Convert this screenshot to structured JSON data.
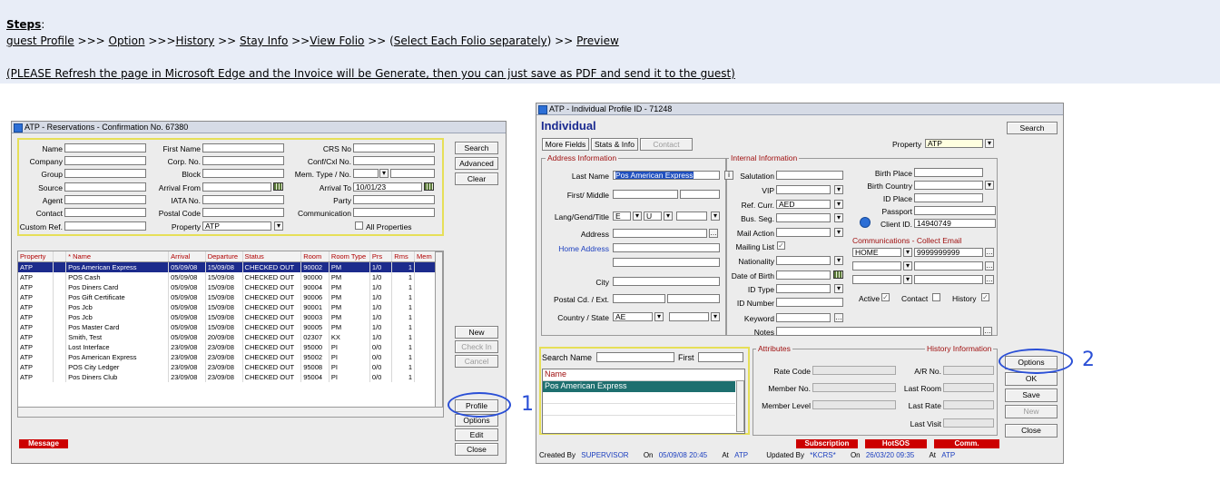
{
  "instructions": {
    "steps_label": "Steps",
    "steps_colon": ":",
    "path": [
      {
        "link": "guest Profile",
        "sep": " >>> "
      },
      {
        "link": "Option",
        "sep": " >>>"
      },
      {
        "link": "History",
        "sep": " >> "
      },
      {
        "link": "Stay Info",
        "sep": " >>"
      },
      {
        "link": "View Folio",
        "sep": " >> ("
      },
      {
        "link": "Select Each Folio separately",
        "sep": ") >> "
      },
      {
        "link": "Preview",
        "sep": ""
      }
    ],
    "note": "(PLEASE Refresh the page in Microsoft Edge and the Invoice will be Generate, then you can just save as PDF and send it to the guest)"
  },
  "reservations": {
    "title": "ATP - Reservations - Confirmation No. 67380",
    "search_labels": {
      "name": "Name",
      "company": "Company",
      "group": "Group",
      "source": "Source",
      "agent": "Agent",
      "contact": "Contact",
      "custom_ref": "Custom Ref.",
      "first_name": "First Name",
      "corp_no": "Corp. No.",
      "block": "Block",
      "arrival_from": "Arrival From",
      "iata_no": "IATA No.",
      "postal_code": "Postal Code",
      "property": "Property",
      "crs_no": "CRS No",
      "conf_cxl_no": "Conf/Cxl No.",
      "mem_type_no": "Mem. Type / No.",
      "arrival_to": "Arrival To",
      "party": "Party",
      "communication": "Communication",
      "all_properties": "All Properties"
    },
    "property_value": "ATP",
    "arrival_to_value": "10/01/23",
    "columns": [
      "Property",
      "",
      "* Name",
      "Arrival",
      "Departure",
      "Status",
      "Room",
      "Room Type",
      "Prs",
      "Rms",
      "Mem"
    ],
    "rows": [
      [
        "ATP",
        "",
        "Pos American Express",
        "05/09/08",
        "15/09/08",
        "CHECKED OUT",
        "90002",
        "PM",
        "1/0",
        "1"
      ],
      [
        "ATP",
        "",
        "POS Cash",
        "05/09/08",
        "15/09/08",
        "CHECKED OUT",
        "90000",
        "PM",
        "1/0",
        "1"
      ],
      [
        "ATP",
        "",
        "Pos Diners Card",
        "05/09/08",
        "15/09/08",
        "CHECKED OUT",
        "90004",
        "PM",
        "1/0",
        "1"
      ],
      [
        "ATP",
        "",
        "Pos Gift Certificate",
        "05/09/08",
        "15/09/08",
        "CHECKED OUT",
        "90006",
        "PM",
        "1/0",
        "1"
      ],
      [
        "ATP",
        "",
        "Pos Jcb",
        "05/09/08",
        "15/09/08",
        "CHECKED OUT",
        "90001",
        "PM",
        "1/0",
        "1"
      ],
      [
        "ATP",
        "",
        "Pos Jcb",
        "05/09/08",
        "15/09/08",
        "CHECKED OUT",
        "90003",
        "PM",
        "1/0",
        "1"
      ],
      [
        "ATP",
        "",
        "Pos Master Card",
        "05/09/08",
        "15/09/08",
        "CHECKED OUT",
        "90005",
        "PM",
        "1/0",
        "1"
      ],
      [
        "ATP",
        "",
        "Smith, Test",
        "05/09/08",
        "20/09/08",
        "CHECKED OUT",
        "02307",
        "KX",
        "1/0",
        "1"
      ],
      [
        "ATP",
        "",
        "Lost Interface",
        "23/09/08",
        "23/09/08",
        "CHECKED OUT",
        "95000",
        "PI",
        "0/0",
        "1"
      ],
      [
        "ATP",
        "",
        "Pos American Express",
        "23/09/08",
        "23/09/08",
        "CHECKED OUT",
        "95002",
        "PI",
        "0/0",
        "1"
      ],
      [
        "ATP",
        "",
        "POS City Ledger",
        "23/09/08",
        "23/09/08",
        "CHECKED OUT",
        "95008",
        "PI",
        "0/0",
        "1"
      ],
      [
        "ATP",
        "",
        "Pos Diners Club",
        "23/09/08",
        "23/09/08",
        "CHECKED OUT",
        "95004",
        "PI",
        "0/0",
        "1"
      ]
    ],
    "buttons": {
      "search": "Search",
      "advanced": "Advanced",
      "clear": "Clear",
      "new": "New",
      "check_in": "Check In",
      "cancel": "Cancel",
      "profile": "Profile",
      "options": "Options",
      "edit": "Edit",
      "close": "Close"
    },
    "message": "Message"
  },
  "profile": {
    "title": "ATP - Individual Profile ID - 71248",
    "heading": "Individual",
    "tabs": {
      "more_fields": "More Fields",
      "stats_info": "Stats & Info",
      "contact": "Contact"
    },
    "property_label": "Property",
    "property_value": "ATP",
    "search_button": "Search",
    "address_section": "Address Information",
    "internal_section": "Internal Information",
    "labels": {
      "last_name": "Last Name",
      "first_middle": "First/ Middle",
      "lang_gend_title": "Lang/Gend/Title",
      "address": "Address",
      "home_address": "Home Address",
      "city": "City",
      "postal_cd_ext": "Postal Cd. / Ext.",
      "country_state": "Country / State",
      "salutation": "Salutation",
      "vip": "VIP",
      "ref_curr": "Ref. Curr.",
      "bus_seg": "Bus. Seg.",
      "mail_action": "Mail Action",
      "mailing_list": "Mailing List",
      "nationality": "Nationality",
      "date_of_birth": "Date of Birth",
      "id_type": "ID Type",
      "id_number": "ID Number",
      "keyword": "Keyword",
      "notes": "Notes",
      "birth_place": "Birth Place",
      "birth_country": "Birth Country",
      "id_place": "ID Place",
      "passport": "Passport",
      "client_id": "Client ID.",
      "active": "Active",
      "contact": "Contact",
      "history": "History"
    },
    "values": {
      "last_name": "Pos American Express",
      "lang": "E",
      "gender": "U",
      "ref_curr": "AED",
      "country": "AE",
      "client_id": "14940749",
      "comm_type": "HOME",
      "comm_value": "9999999999"
    },
    "comm_section": "Communications - Collect Email",
    "search_name_label": "Search Name",
    "first_label": "First",
    "name_list_header": "Name",
    "name_list": [
      "Pos American Express"
    ],
    "attributes_section": "Attributes",
    "history_section": "History Information",
    "attr_labels": {
      "rate_code": "Rate Code",
      "member_no": "Member No.",
      "member_level": "Member Level",
      "ar_no": "A/R No.",
      "last_room": "Last Room",
      "last_rate": "Last Rate",
      "last_visit": "Last Visit"
    },
    "buttons": {
      "options": "Options",
      "ok": "OK",
      "save": "Save",
      "new": "New",
      "close": "Close"
    },
    "red_buttons": [
      "Subscription",
      "HotSOS",
      "Comm."
    ],
    "footer": {
      "created_by_label": "Created By",
      "created_by": "SUPERVISOR",
      "on1_label": "On",
      "on1": "05/09/08 20:45",
      "at1_label": "At",
      "at1": "ATP",
      "updated_by_label": "Updated By",
      "updated_by": "*KCRS*",
      "on2_label": "On",
      "on2": "26/03/20 09:35",
      "at2_label": "At",
      "at2": "ATP"
    }
  },
  "annotations": {
    "one": "1",
    "two": "2"
  }
}
